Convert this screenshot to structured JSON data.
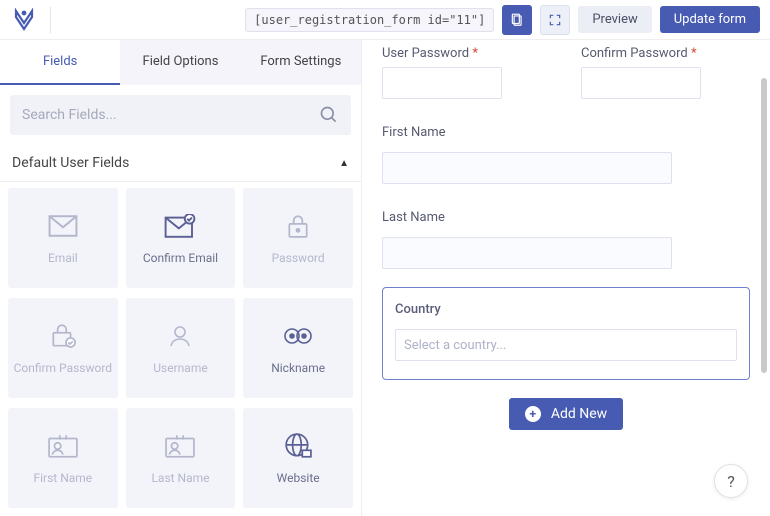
{
  "topbar": {
    "shortcode": "[user_registration_form id=\"11\"]",
    "preview_label": "Preview",
    "update_label": "Update form"
  },
  "tabs": {
    "fields": "Fields",
    "options": "Field Options",
    "settings": "Form Settings"
  },
  "search": {
    "placeholder": "Search Fields..."
  },
  "section": {
    "title": "Default User Fields"
  },
  "tiles": [
    {
      "label": "Email",
      "icon": "mail",
      "disabled": true
    },
    {
      "label": "Confirm Email",
      "icon": "mail-check",
      "disabled": false
    },
    {
      "label": "Password",
      "icon": "lock",
      "disabled": true
    },
    {
      "label": "Confirm Password",
      "icon": "lock-check",
      "disabled": true
    },
    {
      "label": "Username",
      "icon": "user",
      "disabled": true
    },
    {
      "label": "Nickname",
      "icon": "eyes",
      "disabled": false
    },
    {
      "label": "First Name",
      "icon": "id-card",
      "disabled": true
    },
    {
      "label": "Last Name",
      "icon": "id-card",
      "disabled": true
    },
    {
      "label": "Website",
      "icon": "globe",
      "disabled": false
    }
  ],
  "form": {
    "user_password_label": "User Password",
    "confirm_password_label": "Confirm Password",
    "first_name_label": "First Name",
    "last_name_label": "Last Name",
    "country_label": "Country",
    "country_placeholder": "Select a country...",
    "add_new_label": "Add New"
  }
}
